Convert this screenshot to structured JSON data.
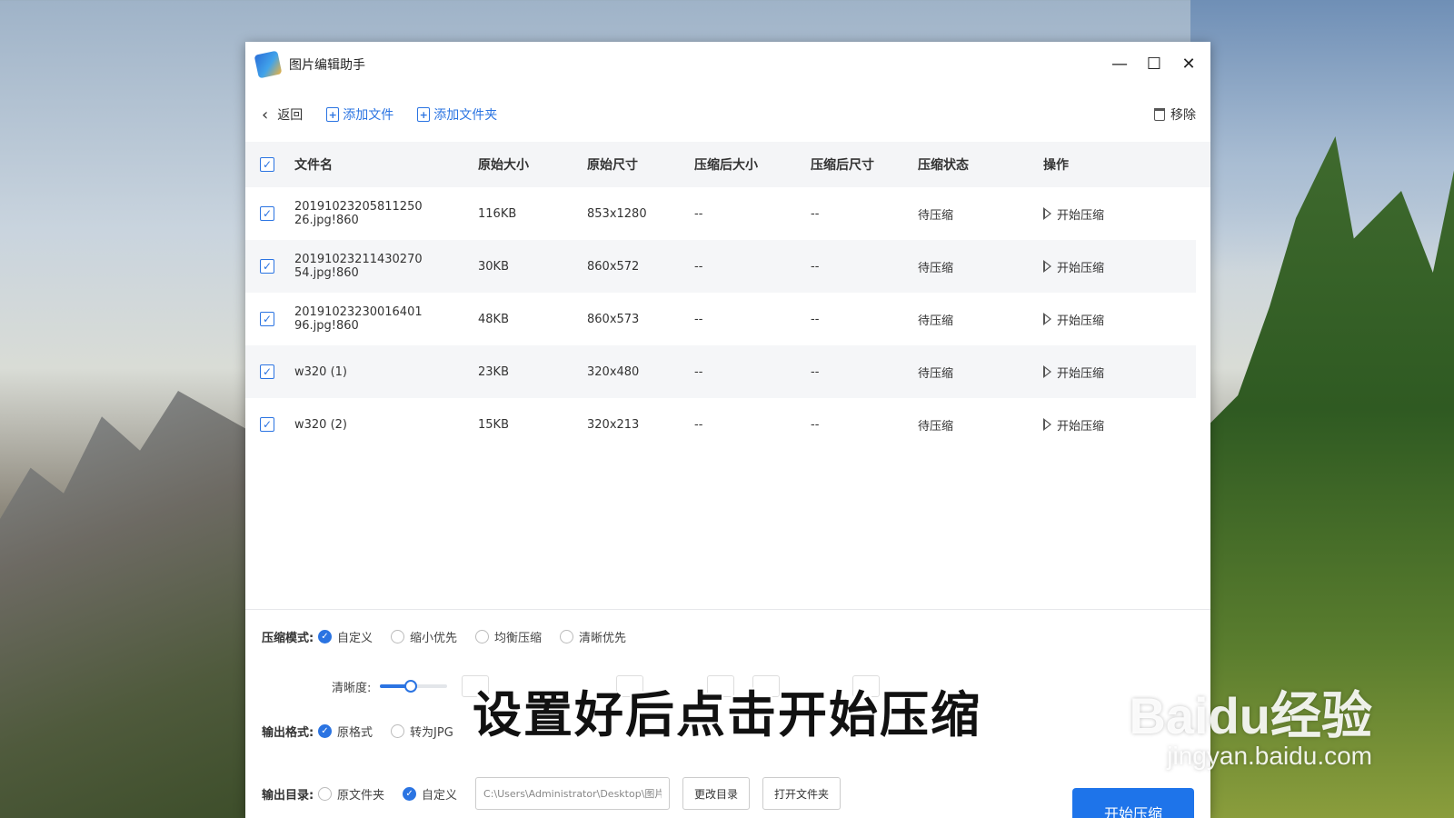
{
  "window": {
    "title": "图片编辑助手",
    "controls": {
      "minimize": "—",
      "maximize": "☐",
      "close": "✕"
    }
  },
  "toolbar": {
    "back_label": "返回",
    "add_file_label": "添加文件",
    "add_folder_label": "添加文件夹",
    "remove_label": "移除"
  },
  "table": {
    "headers": {
      "name": "文件名",
      "orig_size": "原始大小",
      "orig_dim": "原始尺寸",
      "comp_size": "压缩后大小",
      "comp_dim": "压缩后尺寸",
      "status": "压缩状态",
      "op": "操作"
    },
    "rows": [
      {
        "name": "20191023205811250​26.jpg!860",
        "orig_size": "116KB",
        "orig_dim": "853x1280",
        "comp_size": "--",
        "comp_dim": "--",
        "status": "待压缩",
        "op": "开始压缩",
        "checked": true
      },
      {
        "name": "20191023211430270​54.jpg!860",
        "orig_size": "30KB",
        "orig_dim": "860x572",
        "comp_size": "--",
        "comp_dim": "--",
        "status": "待压缩",
        "op": "开始压缩",
        "checked": true
      },
      {
        "name": "20191023230016401​96.jpg!860",
        "orig_size": "48KB",
        "orig_dim": "860x573",
        "comp_size": "--",
        "comp_dim": "--",
        "status": "待压缩",
        "op": "开始压缩",
        "checked": true
      },
      {
        "name": "w320 (1)",
        "orig_size": "23KB",
        "orig_dim": "320x480",
        "comp_size": "--",
        "comp_dim": "--",
        "status": "待压缩",
        "op": "开始压缩",
        "checked": true
      },
      {
        "name": "w320 (2)",
        "orig_size": "15KB",
        "orig_dim": "320x213",
        "comp_size": "--",
        "comp_dim": "--",
        "status": "待压缩",
        "op": "开始压缩",
        "checked": true
      }
    ]
  },
  "settings": {
    "mode_label": "压缩模式:",
    "modes": [
      "自定义",
      "缩小优先",
      "均衡压缩",
      "清晰优先"
    ],
    "mode_selected": "自定义",
    "clarity_label": "清晰度:",
    "clarity_level": 0.45,
    "format_label": "输出格式:",
    "formats": [
      "原格式",
      "转为JPG"
    ],
    "format_selected": "原格式",
    "dir_label": "输出目录:",
    "dir_options": [
      "原文件夹",
      "自定义"
    ],
    "dir_selected": "自定义",
    "dir_path": "C:\\Users\\Administrator\\Desktop\\图片编辑",
    "change_dir_label": "更改目录",
    "open_folder_label": "打开文件夹",
    "start_label": "开始压缩"
  },
  "overlay": {
    "subtitle": "设置好后点击开始压缩",
    "watermark_brand": "Baidu经验",
    "watermark_url": "jingyan.baidu.com"
  },
  "colors": {
    "accent": "#2b74e2",
    "start_button": "#1e74ea"
  }
}
